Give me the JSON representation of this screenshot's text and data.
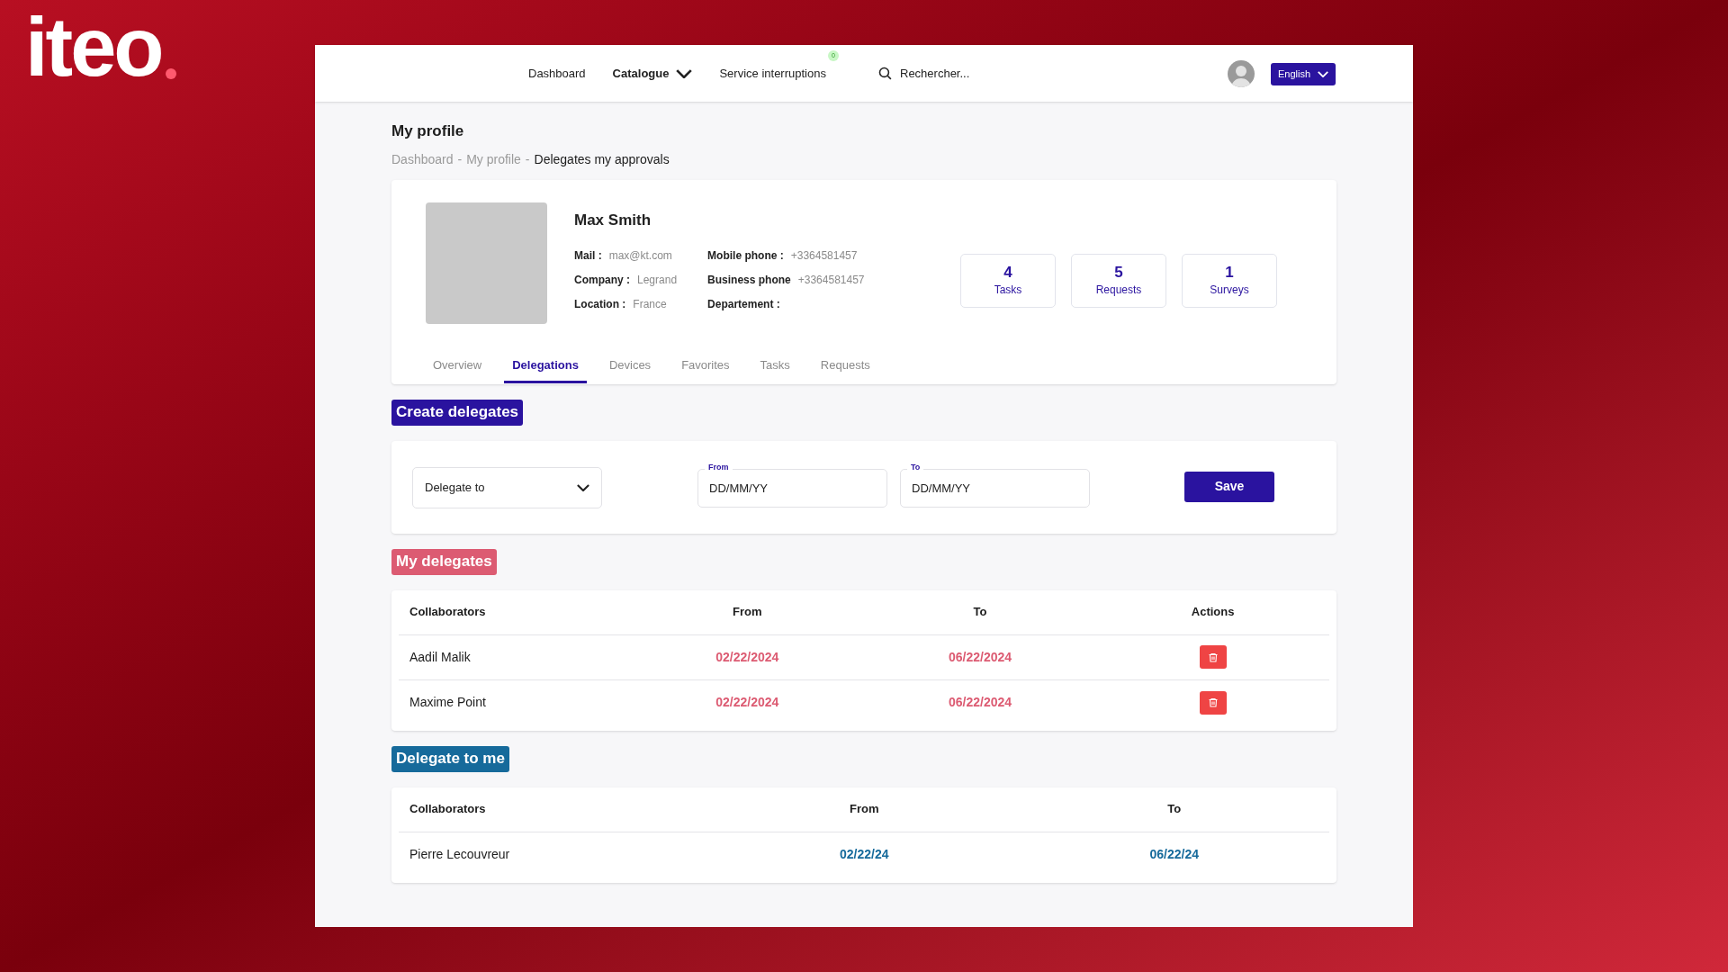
{
  "logo": {
    "text": "iteo"
  },
  "nav": {
    "items": [
      {
        "label": "Dashboard",
        "kind": "link"
      },
      {
        "label": "Catalogue",
        "kind": "dropdown"
      },
      {
        "label": "Service interruptions",
        "kind": "badge",
        "badge": "0"
      }
    ],
    "search": {
      "placeholder": "Rechercher..."
    },
    "language": "English"
  },
  "page": {
    "title": "My profile",
    "separator": "-",
    "breadcrumb": [
      {
        "label": "Dashboard",
        "current": false
      },
      {
        "label": "My profile",
        "current": false
      },
      {
        "label": "Delegates my approvals",
        "current": true
      }
    ]
  },
  "profile": {
    "name": "Max Smith",
    "field_columns": [
      [
        {
          "label": "Mail :",
          "value": "max@kt.com"
        },
        {
          "label": "Company :",
          "value": "Legrand"
        },
        {
          "label": "Location :",
          "value": "France"
        }
      ],
      [
        {
          "label": "Mobile phone :",
          "value": "+3364581457"
        },
        {
          "label": "Business phone",
          "value": "+3364581457"
        },
        {
          "label": "Departement :"
        }
      ]
    ],
    "stats": [
      {
        "value": "4",
        "label": "Tasks"
      },
      {
        "value": "5",
        "label": "Requests"
      },
      {
        "value": "1",
        "label": "Surveys"
      }
    ],
    "tabs": [
      {
        "label": "Overview",
        "selected": false
      },
      {
        "label": "Delegations",
        "selected": true
      },
      {
        "label": "Devices",
        "selected": false
      },
      {
        "label": "Favorites",
        "selected": false
      },
      {
        "label": "Tasks",
        "selected": false
      },
      {
        "label": "Requests",
        "selected": false
      }
    ]
  },
  "create_delegates": {
    "title": "Create delegates",
    "color": "#2a139f",
    "select": {
      "placeholder": "Delegate to"
    },
    "from": {
      "label": "From",
      "placeholder": "DD/MM/YY"
    },
    "to": {
      "label": "To",
      "placeholder": "DD/MM/YY"
    },
    "button": "Save"
  },
  "tables": [
    {
      "title": "My delegates",
      "color": "#dc5b72",
      "columns": [
        {
          "label": "Collaborators",
          "kind": "text"
        },
        {
          "label": "From",
          "kind": "date"
        },
        {
          "label": "To",
          "kind": "date"
        },
        {
          "label": "Actions",
          "kind": "actions"
        }
      ],
      "rows": [
        {
          "cells": [
            "Aadil Malik",
            "02/22/2024",
            "06/22/2024"
          ]
        },
        {
          "cells": [
            "Maxime Point",
            "02/22/2024",
            "06/22/2024"
          ]
        }
      ]
    },
    {
      "title": "Delegate to me",
      "color": "#166a9b",
      "columns": [
        {
          "label": "Collaborators",
          "kind": "text"
        },
        {
          "label": "From",
          "kind": "date"
        },
        {
          "label": "To",
          "kind": "date"
        }
      ],
      "rows": [
        {
          "cells": [
            "Pierre Lecouvreur",
            "02/22/24",
            "06/22/24"
          ]
        }
      ]
    }
  ]
}
